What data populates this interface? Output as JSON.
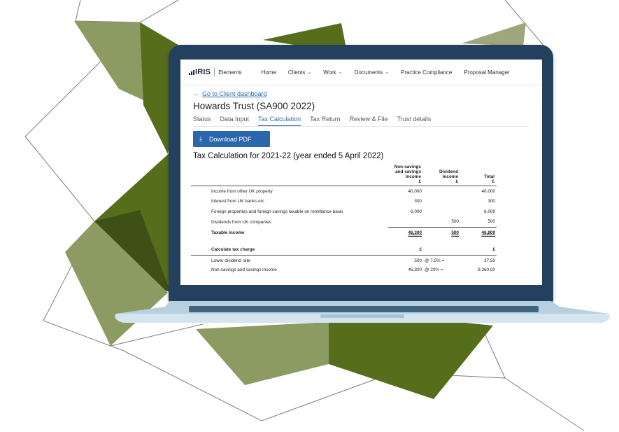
{
  "app": {
    "logo_text": "IRIS",
    "product": "Elements",
    "nav": [
      {
        "label": "Home",
        "dropdown": false
      },
      {
        "label": "Clients",
        "dropdown": true
      },
      {
        "label": "Work",
        "dropdown": true
      },
      {
        "label": "Documents",
        "dropdown": true
      },
      {
        "label": "Practice Compliance",
        "dropdown": false
      },
      {
        "label": "Proposal Manager",
        "dropdown": false
      }
    ]
  },
  "page": {
    "back_link": "Go to Client dashboard",
    "title": "Howards Trust (SA900 2022)",
    "tabs": [
      "Status",
      "Data Input",
      "Tax Calculation",
      "Tax Return",
      "Review & File",
      "Trust details"
    ],
    "active_tab": "Tax Calculation",
    "download_button": "Download PDF",
    "calc_title": "Tax Calculation for 2021-22 (year ended 5 April 2022)"
  },
  "table": {
    "columns": [
      {
        "lines": [
          "Non-savings",
          "and savings",
          "income",
          "£"
        ]
      },
      {
        "lines": [
          "Dividend",
          "income",
          "£"
        ]
      },
      {
        "lines": [
          "Total",
          "£"
        ]
      }
    ],
    "rows": [
      {
        "label": "Income from other UK property",
        "c1": "40,000",
        "c2": "",
        "c3": "40,000"
      },
      {
        "label": "Interest from UK banks etc",
        "c1": "300",
        "c2": "",
        "c3": "300"
      },
      {
        "label": "Foreign properties and foreign savings taxable on remittance basis",
        "c1": "6,000",
        "c2": "",
        "c3": "6,000"
      },
      {
        "label": "Dividends from UK companies",
        "c1": "",
        "c2": "500",
        "c3": "500"
      },
      {
        "label": "Taxable income",
        "c1": "46,300",
        "c2": "500",
        "c3": "46,800"
      }
    ],
    "charge_heading": {
      "label": "Calculate tax charge",
      "c1": "£",
      "c3": "£"
    },
    "charge_rows": [
      {
        "label": "Lower dividend rate",
        "c1": "500",
        "rate": "@ 7.5% =",
        "c3": "37.50"
      },
      {
        "label": "Non-savings and savings income",
        "c1": "46,300",
        "rate": "@ 20% =",
        "c3": "9,260.00"
      }
    ]
  },
  "colors": {
    "accent": "#2b67ae",
    "laptop_frame": "#24405f",
    "laptop_base": "#b6d0e0",
    "shape_dark": "#556b1c",
    "shape_light": "#8c9b62"
  }
}
